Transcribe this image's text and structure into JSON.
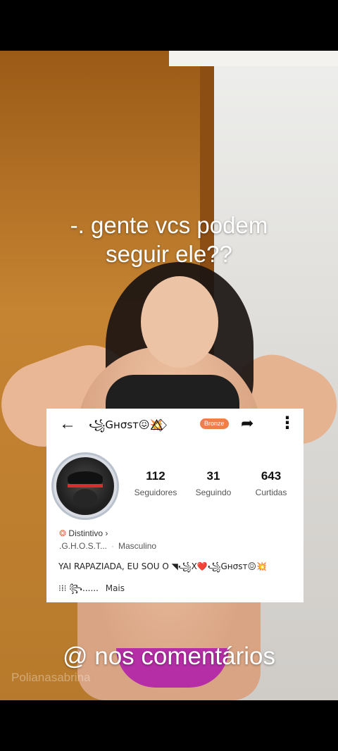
{
  "video": {
    "caption_line1": "-.  gente vcs podem",
    "caption_line2": "seguir ele??",
    "bottom_caption": "@ nos comentários",
    "username": "Polianasabrina"
  },
  "profile_card": {
    "back_icon": "arrow-left-icon",
    "name": "꧁Gнσѕт😖💥⃟⃤",
    "badge": "Bronze",
    "share_icon": "share-arrow-icon",
    "more_icon": "more-vertical-icon",
    "stats": [
      {
        "value": "112",
        "label": "Seguidores"
      },
      {
        "value": "31",
        "label": "Seguindo"
      },
      {
        "value": "643",
        "label": "Curtidas"
      }
    ],
    "distintivo_label": "Distintivo ›",
    "handle": ".G.H.O.S.T...",
    "gender": "Masculino",
    "bio": "YAI RAPAZIADA, EU SOU O ◥꧁X❤️꧁Gнσѕт😖💥",
    "bio_line2": "⁝⁞⁝ ꧂......",
    "more_link": "Mais"
  },
  "colors": {
    "badge_bg": "#ef7f4a",
    "shorts": "#b52ea6"
  }
}
